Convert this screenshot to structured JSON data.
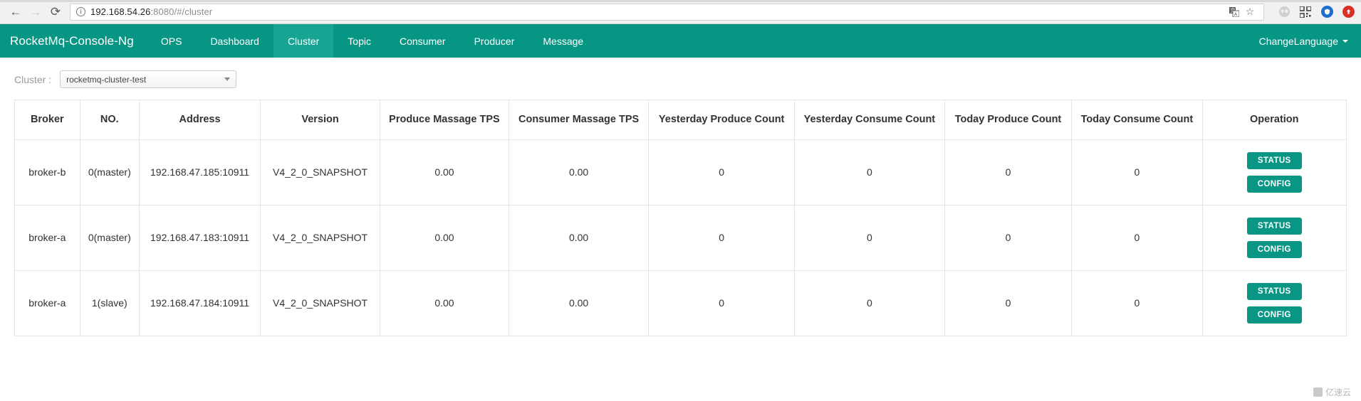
{
  "browser": {
    "back_icon": "back-arrow-icon",
    "forward_icon": "forward-arrow-icon",
    "reload_icon": "reload-icon",
    "url_host": "192.168.54.26",
    "url_rest": ":8080/#/cluster",
    "info_icon_label": "i",
    "translate_icon": "translate-icon",
    "bookmark_icon": "star-icon",
    "ext1_icon": "globe-extension-icon",
    "ext2_icon": "qrcode-extension-icon",
    "ext3_icon": "blue-shield-extension-icon",
    "ext4_icon": "red-circle-extension-icon"
  },
  "navbar": {
    "brand": "RocketMq-Console-Ng",
    "items": [
      {
        "label": "OPS",
        "active": false
      },
      {
        "label": "Dashboard",
        "active": false
      },
      {
        "label": "Cluster",
        "active": true
      },
      {
        "label": "Topic",
        "active": false
      },
      {
        "label": "Consumer",
        "active": false
      },
      {
        "label": "Producer",
        "active": false
      },
      {
        "label": "Message",
        "active": false
      }
    ],
    "language_label": "ChangeLanguage",
    "accent_color": "#089684",
    "accent_active_color": "#18a492"
  },
  "cluster_selector": {
    "label": "Cluster :",
    "value": "rocketmq-cluster-test"
  },
  "table": {
    "headers": [
      "Broker",
      "NO.",
      "Address",
      "Version",
      "Produce Massage TPS",
      "Consumer Massage TPS",
      "Yesterday Produce Count",
      "Yesterday Consume Count",
      "Today Produce Count",
      "Today Consume Count",
      "Operation"
    ],
    "rows": [
      {
        "broker": "broker-b",
        "no": "0(master)",
        "address": "192.168.47.185:10911",
        "version": "V4_2_0_SNAPSHOT",
        "produce_tps": "0.00",
        "consume_tps": "0.00",
        "yesterday_produce": "0",
        "yesterday_consume": "0",
        "today_produce": "0",
        "today_consume": "0",
        "status_label": "STATUS",
        "config_label": "CONFIG"
      },
      {
        "broker": "broker-a",
        "no": "0(master)",
        "address": "192.168.47.183:10911",
        "version": "V4_2_0_SNAPSHOT",
        "produce_tps": "0.00",
        "consume_tps": "0.00",
        "yesterday_produce": "0",
        "yesterday_consume": "0",
        "today_produce": "0",
        "today_consume": "0",
        "status_label": "STATUS",
        "config_label": "CONFIG"
      },
      {
        "broker": "broker-a",
        "no": "1(slave)",
        "address": "192.168.47.184:10911",
        "version": "V4_2_0_SNAPSHOT",
        "produce_tps": "0.00",
        "consume_tps": "0.00",
        "yesterday_produce": "0",
        "yesterday_consume": "0",
        "today_produce": "0",
        "today_consume": "0",
        "status_label": "STATUS",
        "config_label": "CONFIG"
      }
    ],
    "button_color": "#099684"
  },
  "watermark": {
    "text": "亿速云"
  }
}
